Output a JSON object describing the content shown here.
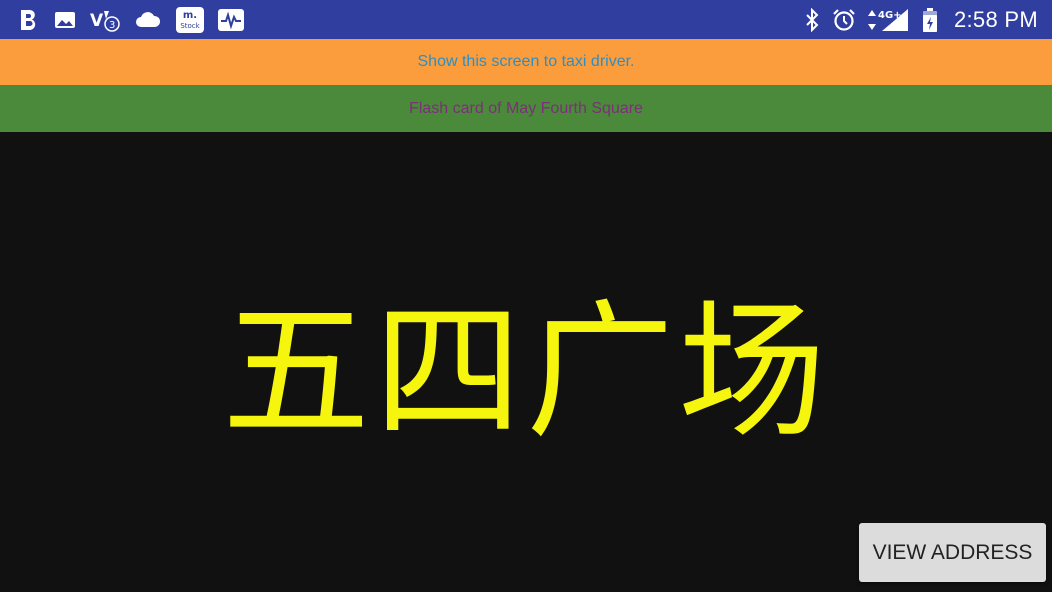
{
  "status_bar": {
    "left_icons": [
      "b-app-icon",
      "gallery-icon",
      "volte-icon",
      "cloud-icon",
      "m-stock-icon",
      "activity-icon"
    ],
    "m_stock_label_top": "m.",
    "m_stock_label_bottom": "Stock",
    "volte_badge": "3",
    "network_label": "4G+",
    "right_icons": [
      "bluetooth-icon",
      "alarm-icon",
      "network-4g-icon",
      "signal-icon",
      "battery-icon"
    ],
    "time": "2:58 PM",
    "background_color": "#303f9f"
  },
  "instruction_banner": {
    "text": "Show this screen to taxi driver.",
    "background_color": "#fb9d3c",
    "text_color": "#2a8fc8"
  },
  "card_banner": {
    "text": "Flash card of May Fourth Square",
    "background_color": "#4a8a3a",
    "text_color": "#7d2f7a"
  },
  "flash_card": {
    "text": "五四广场",
    "text_color": "#f5f50e",
    "background_color": "#111111"
  },
  "actions": {
    "view_address_label": "VIEW ADDRESS"
  }
}
